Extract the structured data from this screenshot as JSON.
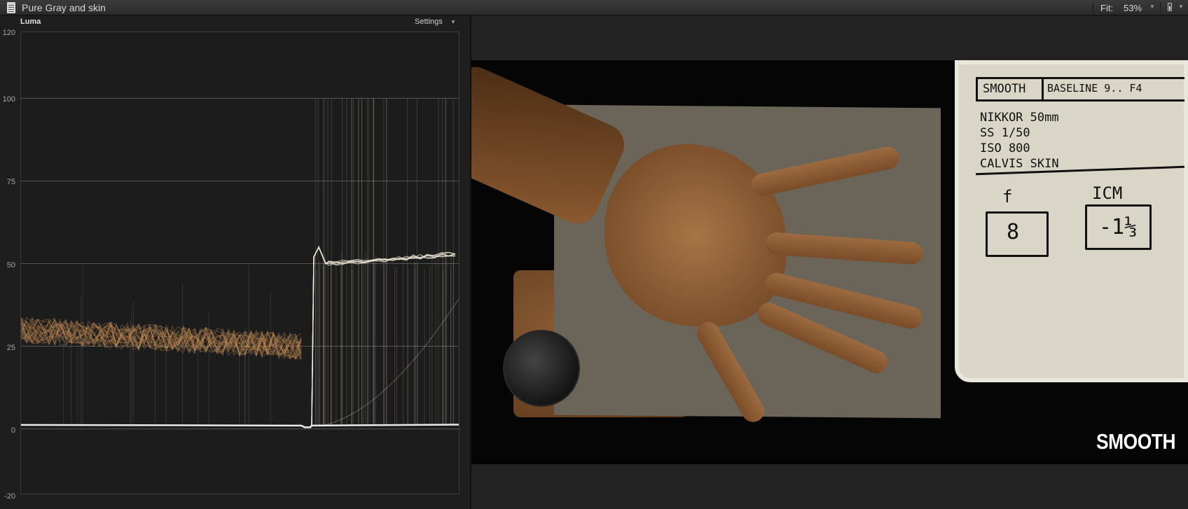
{
  "window": {
    "title": "Pure Gray and skin",
    "fit_label": "Fit:",
    "fit_value": "53%"
  },
  "scope": {
    "name": "Luma",
    "settings_label": "Settings",
    "axis_labels": [
      "120",
      "100",
      "75",
      "50",
      "25",
      "0",
      "-20"
    ],
    "colors": {
      "skin": "#c98f55",
      "trace": "#f3ecd8",
      "grid": "#555555"
    }
  },
  "viewer": {
    "overlay_text": "SMOOTH",
    "slate": {
      "header_left": "SMOOTH",
      "header_right": "BASELINE 9.. F4",
      "lines": [
        "NIKKOR 50mm",
        "SS 1/50",
        "ISO 800",
        "CALVIS SKIN"
      ],
      "label_f": "f",
      "label_icm": "ICM",
      "value_f": "8",
      "value_icm": "-1⅓"
    }
  }
}
